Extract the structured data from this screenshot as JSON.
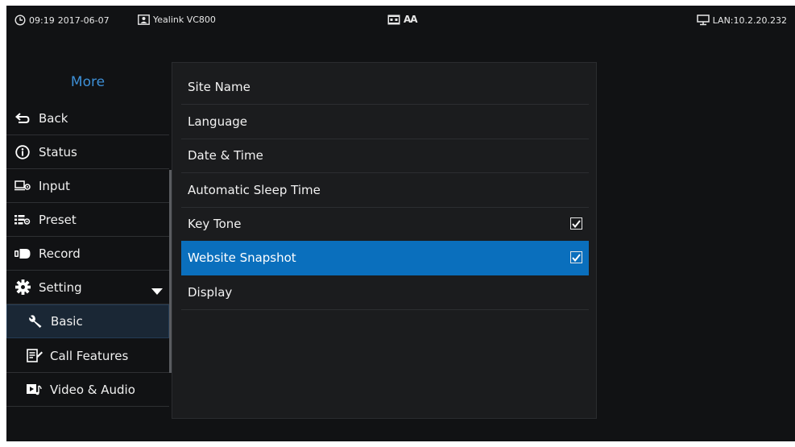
{
  "status_bar": {
    "time": "09:19",
    "date": "2017-06-07",
    "device": "Yealink VC800",
    "font_size_label": "AA",
    "network": "LAN:10.2.20.232",
    "icons": [
      "clock-icon",
      "contact-card-icon",
      "vcr-input-icon",
      "font-size-icon",
      "lan-monitor-icon"
    ]
  },
  "sidebar": {
    "title": "More",
    "items": [
      {
        "label": "Back",
        "icon": "back-arrow-icon"
      },
      {
        "label": "Status",
        "icon": "info-icon"
      },
      {
        "label": "Input",
        "icon": "input-source-icon"
      },
      {
        "label": "Preset",
        "icon": "preset-icon"
      },
      {
        "label": "Record",
        "icon": "record-icon"
      },
      {
        "label": "Setting",
        "icon": "gear-icon",
        "expanded": true
      },
      {
        "label": "Basic",
        "icon": "wrench-icon",
        "selected": true
      },
      {
        "label": "Call Features",
        "icon": "call-features-icon"
      },
      {
        "label": "Video & Audio",
        "icon": "video-audio-icon"
      }
    ]
  },
  "main": {
    "rows": [
      {
        "label": "Site Name"
      },
      {
        "label": "Language"
      },
      {
        "label": "Date & Time"
      },
      {
        "label": "Automatic Sleep Time"
      },
      {
        "label": "Key Tone",
        "checked": true
      },
      {
        "label": "Website Snapshot",
        "checked": true,
        "highlighted": true
      },
      {
        "label": "Display"
      }
    ]
  },
  "colors": {
    "background": "#111214",
    "panel": "#1b1c1e",
    "accent_title": "#3d8fd6",
    "highlight": "#0a6fbd",
    "selected_sidebar": "#1a2735"
  }
}
